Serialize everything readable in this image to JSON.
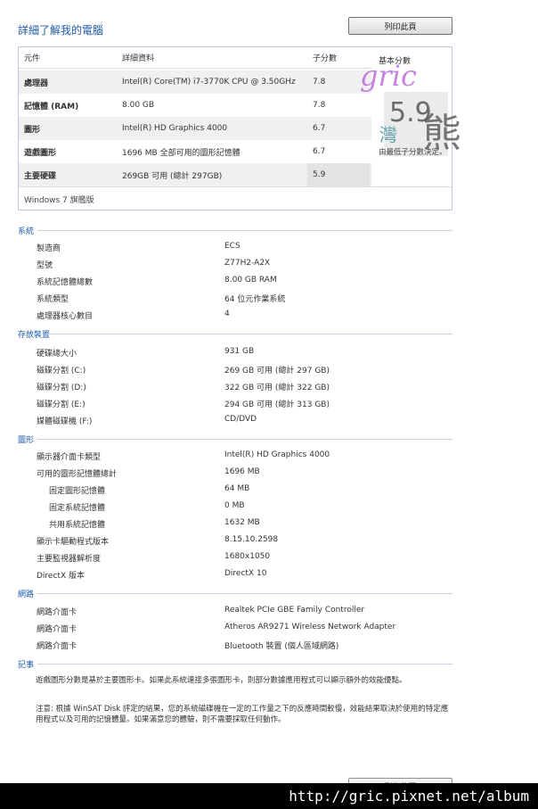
{
  "page_title": "詳細了解我的電腦",
  "print_button": "列印此頁",
  "score_table": {
    "headers": {
      "component": "元件",
      "details": "詳細資料",
      "subscore": "子分數",
      "base": "基本分數"
    },
    "rows": [
      {
        "component": "處理器",
        "details": "Intel(R) Core(TM) i7-3770K CPU @ 3.50GHz",
        "score": "7.8"
      },
      {
        "component": "記憶體 (RAM)",
        "details": "8.00 GB",
        "score": "7.8"
      },
      {
        "component": "圖形",
        "details": "Intel(R) HD Graphics 4000",
        "score": "6.7"
      },
      {
        "component": "遊戲圖形",
        "details": "1696 MB 全部可用的圖形記憶體",
        "score": "6.7"
      },
      {
        "component": "主要硬碟",
        "details": "269GB 可用 (總計 297GB)",
        "score": "5.9"
      }
    ],
    "base_score": "5.9",
    "base_desc": "由最低子分數決定。",
    "edition": "Windows 7 旗艦版"
  },
  "system": {
    "title": "系統",
    "items": [
      {
        "k": "製造商",
        "v": "ECS"
      },
      {
        "k": "型號",
        "v": "Z77H2-A2X"
      },
      {
        "k": "系統記憶體總數",
        "v": "8.00 GB RAM"
      },
      {
        "k": "系統類型",
        "v": "64 位元作業系統"
      },
      {
        "k": "處理器核心數目",
        "v": "4"
      }
    ]
  },
  "storage": {
    "title": "存放裝置",
    "items": [
      {
        "k": "硬碟總大小",
        "v": "931 GB"
      },
      {
        "k": "磁碟分割 (C:)",
        "v": "269 GB 可用 (總計 297 GB)"
      },
      {
        "k": "磁碟分割 (D:)",
        "v": "322 GB 可用 (總計 322 GB)"
      },
      {
        "k": "磁碟分割 (E:)",
        "v": "294 GB 可用 (總計 313 GB)"
      },
      {
        "k": "媒體磁碟機 (F:)",
        "v": "CD/DVD"
      }
    ]
  },
  "graphics": {
    "title": "圖形",
    "items": [
      {
        "k": "顯示器介面卡類型",
        "v": "Intel(R) HD Graphics 4000"
      },
      {
        "k": "可用的圖形記憶體總計",
        "v": "1696 MB"
      },
      {
        "k": "固定圖形記憶體",
        "v": "64 MB"
      },
      {
        "k": "固定系統記憶體",
        "v": "0 MB"
      },
      {
        "k": "共用系統記憶體",
        "v": "1632 MB"
      },
      {
        "k": "顯示卡驅動程式版本",
        "v": "8.15.10.2598"
      },
      {
        "k": "主要監視器解析度",
        "v": "1680x1050"
      },
      {
        "k": "DirectX 版本",
        "v": "DirectX 10"
      }
    ]
  },
  "network": {
    "title": "網路",
    "items": [
      {
        "k": "網路介面卡",
        "v": "Realtek PCIe GBE Family Controller"
      },
      {
        "k": "網路介面卡",
        "v": "Atheros AR9271 Wireless Network Adapter"
      },
      {
        "k": "網路介面卡",
        "v": "Bluetooth 裝置 (個人區域網路)"
      }
    ]
  },
  "notes": {
    "title": "記事",
    "note1": "遊戲圖形分數是基於主要圖形卡。如果此系統連接多張圖形卡，則部分數據應用程式可以顯示額外的效能優點。",
    "note2": "注意: 根據 WinSAT Disk 評定的結果，您的系統磁碟機在一定的工作量之下的反應時間較慢，效能結果取決於使用的特定應用程式以及可用的記憶體量。如果滿意您的體驗，則不需要採取任何動作。"
  },
  "watermark_text": "gric",
  "watermark_bear": "熊",
  "watermark_sub": "灣",
  "url_footer": "http://gric.pixnet.net/album",
  "colors": {
    "accent": "#1e5aa8",
    "watermark": "#b25bd6"
  }
}
